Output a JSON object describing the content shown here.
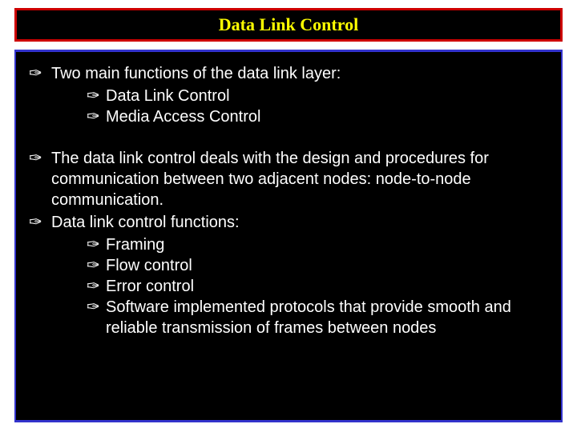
{
  "title": "Data Link Control",
  "bullet_glyph": "✑",
  "block1": {
    "line": "Two main functions of the data link layer:",
    "subs": [
      "Data Link Control",
      "Media Access Control"
    ]
  },
  "block2": {
    "line1": "The data link control deals with the design and procedures for communication between two adjacent nodes: node-to-node communication.",
    "line2": "Data link control functions:",
    "subs": [
      "Framing",
      "Flow control",
      "Error control",
      "Software implemented protocols that provide smooth and reliable transmission of frames between nodes"
    ]
  }
}
